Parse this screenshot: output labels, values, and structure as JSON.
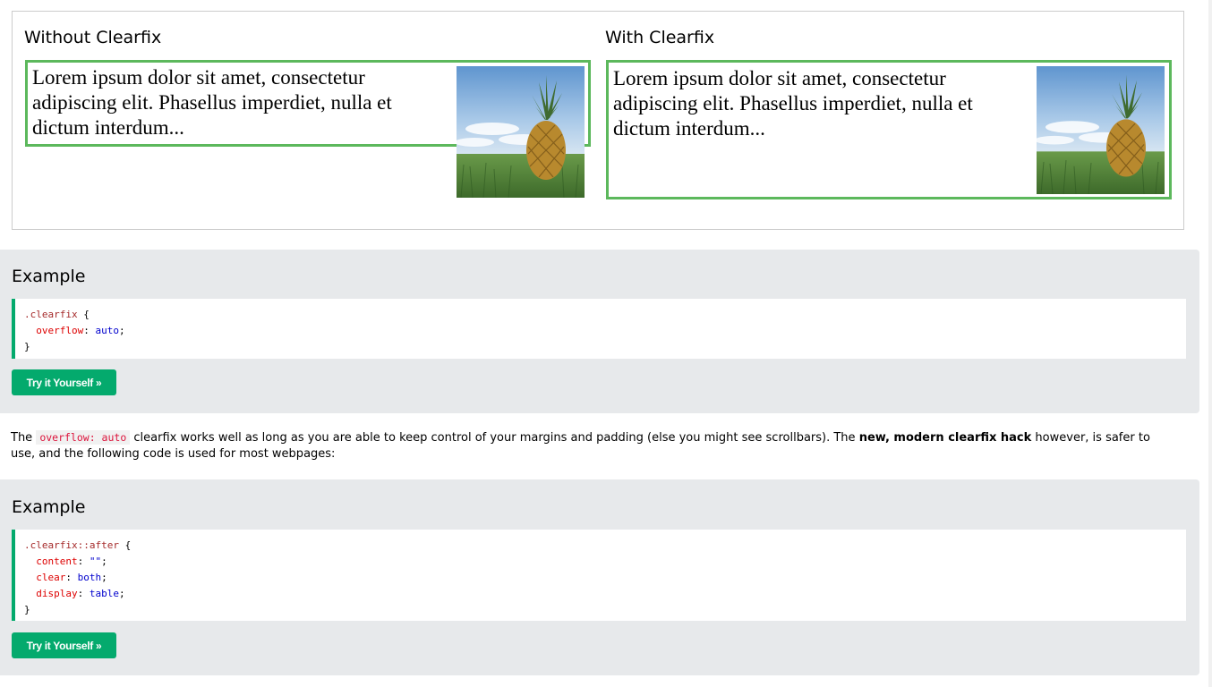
{
  "demo": {
    "left_title": "Without Clearfix",
    "right_title": "With Clearfix",
    "lorem_text": "Lorem ipsum dolor sit amet, consectetur adipiscing elit. Phasellus imperdiet, nulla et dictum interdum..."
  },
  "example1": {
    "heading": "Example",
    "code": {
      "selector": ".clearfix",
      "open": " {",
      "prop1": "overflow",
      "val1": "auto",
      "close": "}"
    },
    "button": "Try it Yourself »"
  },
  "paragraph": {
    "part1": "The ",
    "code": "overflow: auto",
    "part2": " clearfix works well as long as you are able to keep control of your margins and padding (else you might see scrollbars). The ",
    "bold": "new, modern clearfix hack",
    "part3": " however, is safer to use, and the following code is used for most webpages:"
  },
  "example2": {
    "heading": "Example",
    "code": {
      "selector": ".clearfix::after",
      "open": " {",
      "prop1": "content",
      "val1": "\"\"",
      "prop2": "clear",
      "val2": "both",
      "prop3": "display",
      "val3": "table",
      "close": "}"
    },
    "button": "Try it Yourself »"
  },
  "colors": {
    "green_border": "#5cb85c",
    "button_green": "#04aa6d",
    "example_bg": "#e7e9eb"
  },
  "icons": [
    "pineapple-image"
  ]
}
